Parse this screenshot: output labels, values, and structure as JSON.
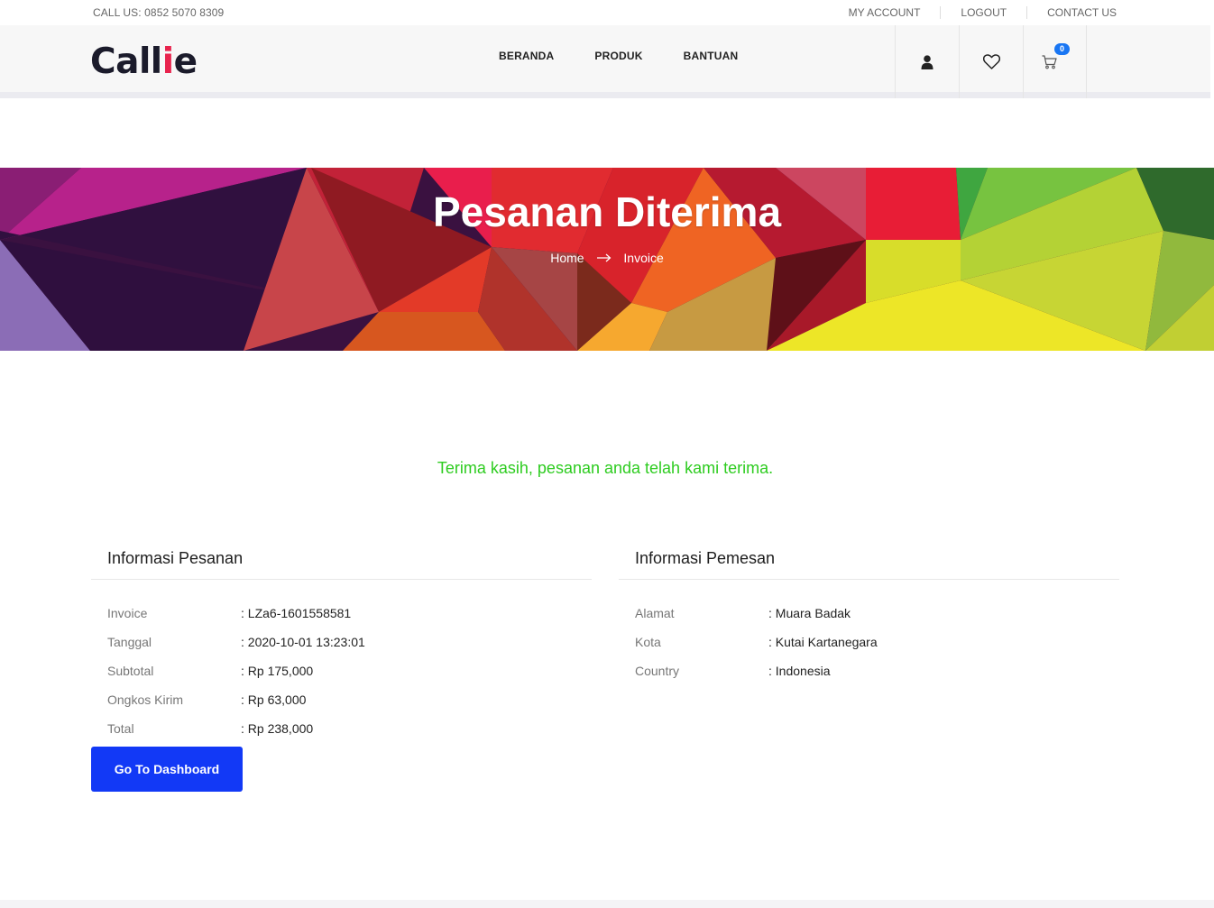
{
  "topbar": {
    "phone": "CALL US: 0852 5070 8309",
    "links": [
      "MY ACCOUNT",
      "LOGOUT",
      "CONTACT US"
    ]
  },
  "header": {
    "logo_main": "Call",
    "logo_accent_i": "i",
    "logo_end": "e",
    "nav": [
      "BERANDA",
      "PRODUK",
      "BANTUAN"
    ],
    "cart_count": "0",
    "accent_color": "#e8234d"
  },
  "banner": {
    "title": "Pesanan Diterima",
    "breadcrumb_home": "Home",
    "breadcrumb_current": "Invoice"
  },
  "main": {
    "thanks_message": "Terima kasih, pesanan anda telah kami terima.",
    "order_info": {
      "title": "Informasi Pesanan",
      "rows": [
        {
          "label": "Invoice",
          "value": ": LZa6-1601558581"
        },
        {
          "label": "Tanggal",
          "value": ": 2020-10-01 13:23:01"
        },
        {
          "label": "Subtotal",
          "value": ": Rp 175,000"
        },
        {
          "label": "Ongkos Kirim",
          "value": ": Rp 63,000"
        },
        {
          "label": "Total",
          "value": ": Rp 238,000"
        }
      ]
    },
    "customer_info": {
      "title": "Informasi Pemesan",
      "rows": [
        {
          "label": "Alamat",
          "value": ": Muara Badak"
        },
        {
          "label": "Kota",
          "value": ": Kutai Kartanegara"
        },
        {
          "label": "Country",
          "value": ": Indonesia"
        }
      ]
    },
    "dashboard_button": "Go To Dashboard",
    "button_color": "#1239f6",
    "success_color": "#2ecc20"
  }
}
